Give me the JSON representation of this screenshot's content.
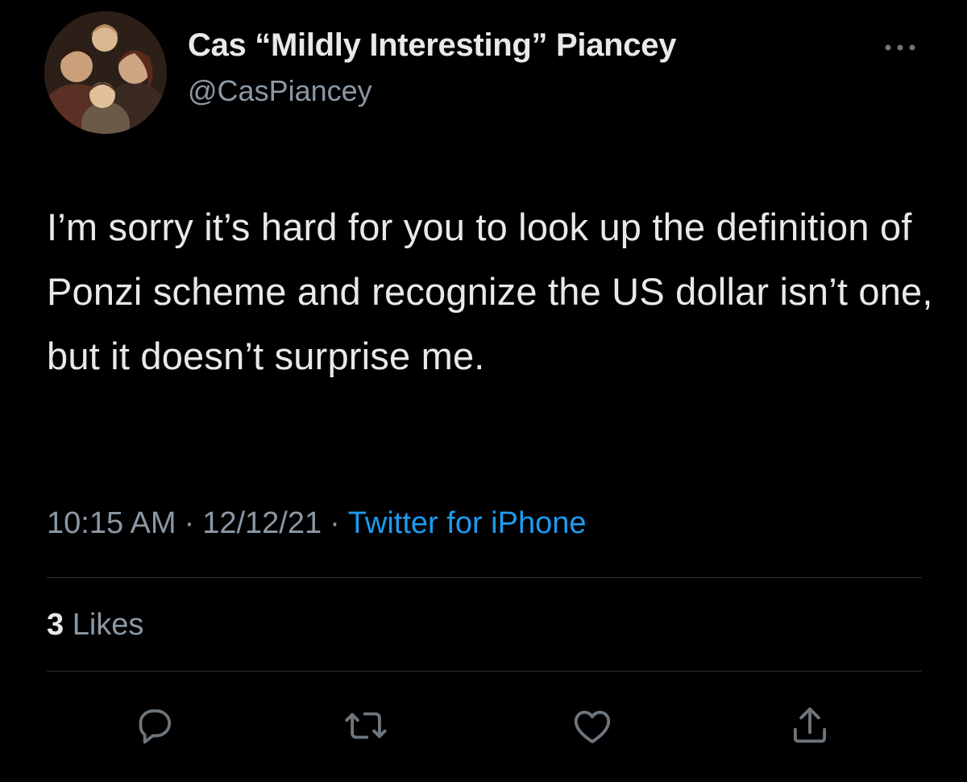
{
  "author": {
    "display_name": "Cas “Mildly Interesting” Piancey",
    "handle": "@CasPiancey",
    "avatar_icon": "profile-photo"
  },
  "tweet": {
    "text": "I’m sorry it’s hard for you to look up the definition of Ponzi scheme and recognize the US dollar isn’t one, but it doesn’t surprise me.",
    "time": "10:15 AM",
    "date": "12/12/21",
    "separator": "·",
    "source": "Twitter for iPhone"
  },
  "stats": {
    "likes_count": "3",
    "likes_label": "Likes"
  },
  "actions": [
    {
      "name": "reply",
      "icon": "reply-icon"
    },
    {
      "name": "retweet",
      "icon": "retweet-icon"
    },
    {
      "name": "like",
      "icon": "heart-icon"
    },
    {
      "name": "share",
      "icon": "share-icon"
    }
  ],
  "colors": {
    "background": "#000000",
    "text_primary": "#e7e9ea",
    "text_secondary": "#8b98a5",
    "link": "#1d9bf0",
    "divider": "#2f3336"
  }
}
